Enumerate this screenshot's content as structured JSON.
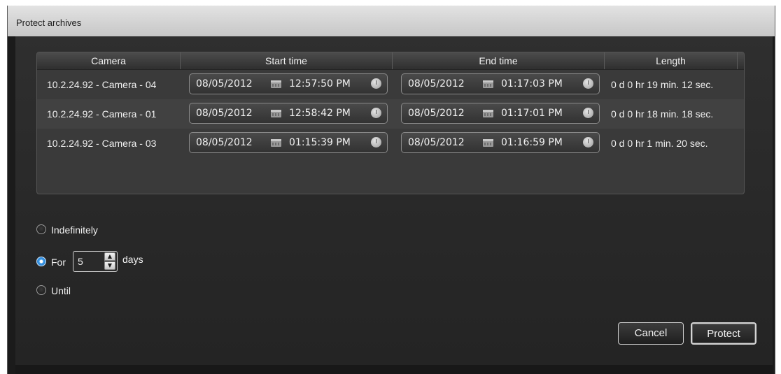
{
  "window": {
    "title": "Protect archives"
  },
  "table": {
    "headers": [
      "Camera",
      "Start time",
      "End time",
      "Length"
    ],
    "rows": [
      {
        "camera": "10.2.24.92 - Camera - 04",
        "start_date": "08/05/2012",
        "start_time": "12:57:50 PM",
        "end_date": "08/05/2012",
        "end_time": "01:17:03 PM",
        "length": "0 d 0 hr 19 min. 12 sec."
      },
      {
        "camera": "10.2.24.92 - Camera - 01",
        "start_date": "08/05/2012",
        "start_time": "12:58:42 PM",
        "end_date": "08/05/2012",
        "end_time": "01:17:01 PM",
        "length": "0 d 0 hr 18 min. 18 sec."
      },
      {
        "camera": "10.2.24.92 - Camera - 03",
        "start_date": "08/05/2012",
        "start_time": "01:15:39 PM",
        "end_date": "08/05/2012",
        "end_time": "01:16:59 PM",
        "length": "0 d 0 hr 1 min. 20 sec."
      }
    ]
  },
  "options": {
    "indefinitely_label": "Indefinitely",
    "for_label": "For",
    "days_value": "5",
    "days_label": "days",
    "until_label": "Until",
    "selected": "For"
  },
  "buttons": {
    "cancel_label": "Cancel",
    "protect_label": "Protect"
  },
  "colors": {
    "radio_selected": "#3d9be9",
    "panel_background": "#2a2a2a"
  },
  "icons": {
    "calendar": "calendar-icon",
    "clock": "clock-icon",
    "spin_up": "spin-up-icon",
    "spin_down": "spin-down-icon"
  }
}
